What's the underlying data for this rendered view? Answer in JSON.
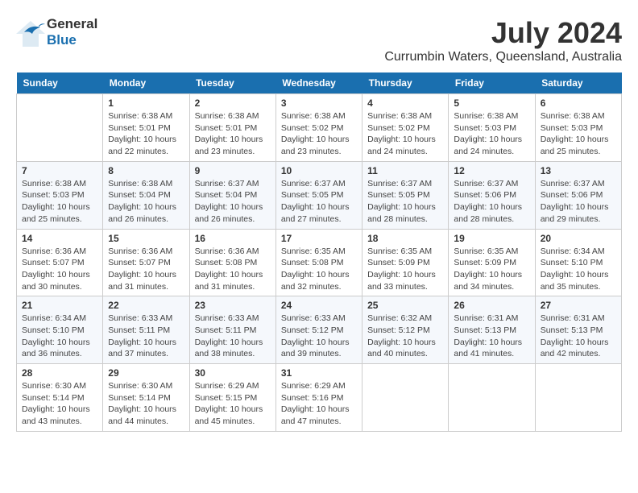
{
  "header": {
    "logo_general": "General",
    "logo_blue": "Blue",
    "month_year": "July 2024",
    "location": "Currumbin Waters, Queensland, Australia"
  },
  "days_of_week": [
    "Sunday",
    "Monday",
    "Tuesday",
    "Wednesday",
    "Thursday",
    "Friday",
    "Saturday"
  ],
  "weeks": [
    [
      {
        "day": "",
        "info": ""
      },
      {
        "day": "1",
        "info": "Sunrise: 6:38 AM\nSunset: 5:01 PM\nDaylight: 10 hours\nand 22 minutes."
      },
      {
        "day": "2",
        "info": "Sunrise: 6:38 AM\nSunset: 5:01 PM\nDaylight: 10 hours\nand 23 minutes."
      },
      {
        "day": "3",
        "info": "Sunrise: 6:38 AM\nSunset: 5:02 PM\nDaylight: 10 hours\nand 23 minutes."
      },
      {
        "day": "4",
        "info": "Sunrise: 6:38 AM\nSunset: 5:02 PM\nDaylight: 10 hours\nand 24 minutes."
      },
      {
        "day": "5",
        "info": "Sunrise: 6:38 AM\nSunset: 5:03 PM\nDaylight: 10 hours\nand 24 minutes."
      },
      {
        "day": "6",
        "info": "Sunrise: 6:38 AM\nSunset: 5:03 PM\nDaylight: 10 hours\nand 25 minutes."
      }
    ],
    [
      {
        "day": "7",
        "info": "Sunrise: 6:38 AM\nSunset: 5:03 PM\nDaylight: 10 hours\nand 25 minutes."
      },
      {
        "day": "8",
        "info": "Sunrise: 6:38 AM\nSunset: 5:04 PM\nDaylight: 10 hours\nand 26 minutes."
      },
      {
        "day": "9",
        "info": "Sunrise: 6:37 AM\nSunset: 5:04 PM\nDaylight: 10 hours\nand 26 minutes."
      },
      {
        "day": "10",
        "info": "Sunrise: 6:37 AM\nSunset: 5:05 PM\nDaylight: 10 hours\nand 27 minutes."
      },
      {
        "day": "11",
        "info": "Sunrise: 6:37 AM\nSunset: 5:05 PM\nDaylight: 10 hours\nand 28 minutes."
      },
      {
        "day": "12",
        "info": "Sunrise: 6:37 AM\nSunset: 5:06 PM\nDaylight: 10 hours\nand 28 minutes."
      },
      {
        "day": "13",
        "info": "Sunrise: 6:37 AM\nSunset: 5:06 PM\nDaylight: 10 hours\nand 29 minutes."
      }
    ],
    [
      {
        "day": "14",
        "info": "Sunrise: 6:36 AM\nSunset: 5:07 PM\nDaylight: 10 hours\nand 30 minutes."
      },
      {
        "day": "15",
        "info": "Sunrise: 6:36 AM\nSunset: 5:07 PM\nDaylight: 10 hours\nand 31 minutes."
      },
      {
        "day": "16",
        "info": "Sunrise: 6:36 AM\nSunset: 5:08 PM\nDaylight: 10 hours\nand 31 minutes."
      },
      {
        "day": "17",
        "info": "Sunrise: 6:35 AM\nSunset: 5:08 PM\nDaylight: 10 hours\nand 32 minutes."
      },
      {
        "day": "18",
        "info": "Sunrise: 6:35 AM\nSunset: 5:09 PM\nDaylight: 10 hours\nand 33 minutes."
      },
      {
        "day": "19",
        "info": "Sunrise: 6:35 AM\nSunset: 5:09 PM\nDaylight: 10 hours\nand 34 minutes."
      },
      {
        "day": "20",
        "info": "Sunrise: 6:34 AM\nSunset: 5:10 PM\nDaylight: 10 hours\nand 35 minutes."
      }
    ],
    [
      {
        "day": "21",
        "info": "Sunrise: 6:34 AM\nSunset: 5:10 PM\nDaylight: 10 hours\nand 36 minutes."
      },
      {
        "day": "22",
        "info": "Sunrise: 6:33 AM\nSunset: 5:11 PM\nDaylight: 10 hours\nand 37 minutes."
      },
      {
        "day": "23",
        "info": "Sunrise: 6:33 AM\nSunset: 5:11 PM\nDaylight: 10 hours\nand 38 minutes."
      },
      {
        "day": "24",
        "info": "Sunrise: 6:33 AM\nSunset: 5:12 PM\nDaylight: 10 hours\nand 39 minutes."
      },
      {
        "day": "25",
        "info": "Sunrise: 6:32 AM\nSunset: 5:12 PM\nDaylight: 10 hours\nand 40 minutes."
      },
      {
        "day": "26",
        "info": "Sunrise: 6:31 AM\nSunset: 5:13 PM\nDaylight: 10 hours\nand 41 minutes."
      },
      {
        "day": "27",
        "info": "Sunrise: 6:31 AM\nSunset: 5:13 PM\nDaylight: 10 hours\nand 42 minutes."
      }
    ],
    [
      {
        "day": "28",
        "info": "Sunrise: 6:30 AM\nSunset: 5:14 PM\nDaylight: 10 hours\nand 43 minutes."
      },
      {
        "day": "29",
        "info": "Sunrise: 6:30 AM\nSunset: 5:14 PM\nDaylight: 10 hours\nand 44 minutes."
      },
      {
        "day": "30",
        "info": "Sunrise: 6:29 AM\nSunset: 5:15 PM\nDaylight: 10 hours\nand 45 minutes."
      },
      {
        "day": "31",
        "info": "Sunrise: 6:29 AM\nSunset: 5:16 PM\nDaylight: 10 hours\nand 47 minutes."
      },
      {
        "day": "",
        "info": ""
      },
      {
        "day": "",
        "info": ""
      },
      {
        "day": "",
        "info": ""
      }
    ]
  ]
}
